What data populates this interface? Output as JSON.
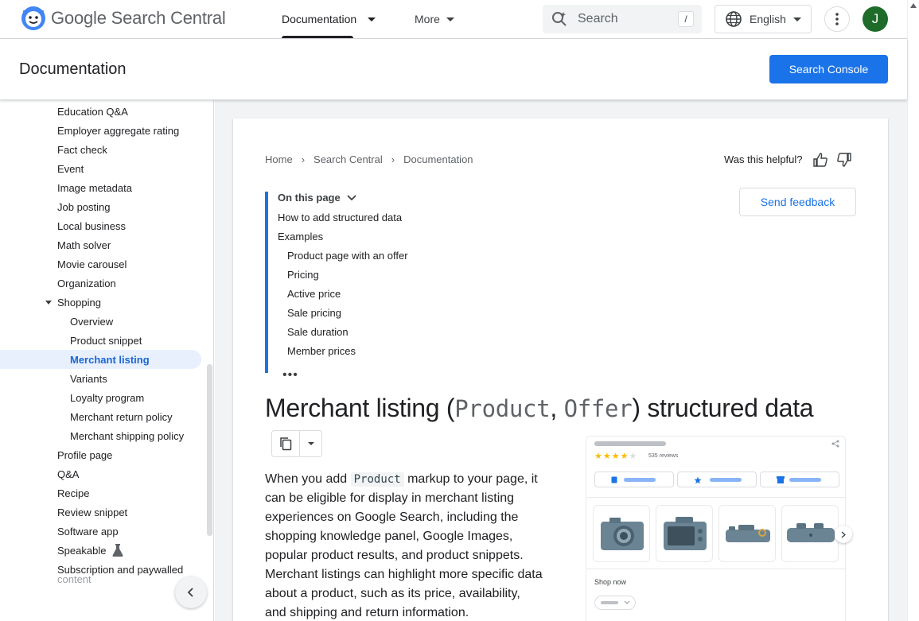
{
  "header": {
    "brand": "Google Search Central",
    "nav": [
      {
        "label": "Documentation"
      },
      {
        "label": "More"
      }
    ],
    "search": {
      "placeholder": "Search",
      "shortcut": "/"
    },
    "language": "English",
    "avatar_letter": "J"
  },
  "subheader": {
    "title": "Documentation",
    "console_button": "Search Console"
  },
  "sidebar": {
    "items": [
      {
        "label": "Education Q&A",
        "level": 1
      },
      {
        "label": "Employer aggregate rating",
        "level": 1
      },
      {
        "label": "Fact check",
        "level": 1
      },
      {
        "label": "Event",
        "level": 1
      },
      {
        "label": "Image metadata",
        "level": 1
      },
      {
        "label": "Job posting",
        "level": 1
      },
      {
        "label": "Local business",
        "level": 1
      },
      {
        "label": "Math solver",
        "level": 1
      },
      {
        "label": "Movie carousel",
        "level": 1
      },
      {
        "label": "Organization",
        "level": 1
      },
      {
        "label": "Shopping",
        "level": 1,
        "expanded": true
      },
      {
        "label": "Overview",
        "level": 2
      },
      {
        "label": "Product snippet",
        "level": 2
      },
      {
        "label": "Merchant listing",
        "level": 2,
        "selected": true
      },
      {
        "label": "Variants",
        "level": 2
      },
      {
        "label": "Loyalty program",
        "level": 2
      },
      {
        "label": "Merchant return policy",
        "level": 2
      },
      {
        "label": "Merchant shipping policy",
        "level": 2
      },
      {
        "label": "Profile page",
        "level": 1
      },
      {
        "label": "Q&A",
        "level": 1
      },
      {
        "label": "Recipe",
        "level": 1
      },
      {
        "label": "Review snippet",
        "level": 1
      },
      {
        "label": "Software app",
        "level": 1
      },
      {
        "label": "Speakable",
        "level": 1,
        "beta": true
      },
      {
        "label": "Subscription and paywalled",
        "level": 1
      },
      {
        "label": "content",
        "level": 1,
        "faded": true
      }
    ]
  },
  "breadcrumb": [
    "Home",
    "Search Central",
    "Documentation"
  ],
  "helpful_label": "Was this helpful?",
  "feedback_button": "Send feedback",
  "toc": {
    "heading": "On this page",
    "items": [
      {
        "label": "How to add structured data",
        "level": 1
      },
      {
        "label": "Examples",
        "level": 1
      },
      {
        "label": "Product page with an offer",
        "level": 2
      },
      {
        "label": "Pricing",
        "level": 2
      },
      {
        "label": "Active price",
        "level": 2
      },
      {
        "label": "Sale pricing",
        "level": 2
      },
      {
        "label": "Sale duration",
        "level": 2
      },
      {
        "label": "Member prices",
        "level": 2
      }
    ],
    "more": "•••"
  },
  "article": {
    "title_prefix": "Merchant listing (",
    "title_code1": "Product",
    "title_sep": ", ",
    "title_code2": "Offer",
    "title_suffix": ") structured data",
    "para_before": "When you add ",
    "para_code": "Product",
    "para_after": " markup to your page, it can be eligible for display in merchant listing experiences on Google Search, including the shopping knowledge panel, Google Images, popular product results, and product snippets. Merchant listings can highlight more specific data about a product, such as its price, availability, and shipping and return information."
  },
  "illustration": {
    "stars": "★★★★★",
    "rating": 4,
    "reviews": "535 reviews",
    "shop_now": "Shop now"
  },
  "colors": {
    "accent": "#1a73e8",
    "selected_bg": "#e8f0fe",
    "avatar": "#1e6b2a",
    "star": "#fbbc04"
  }
}
